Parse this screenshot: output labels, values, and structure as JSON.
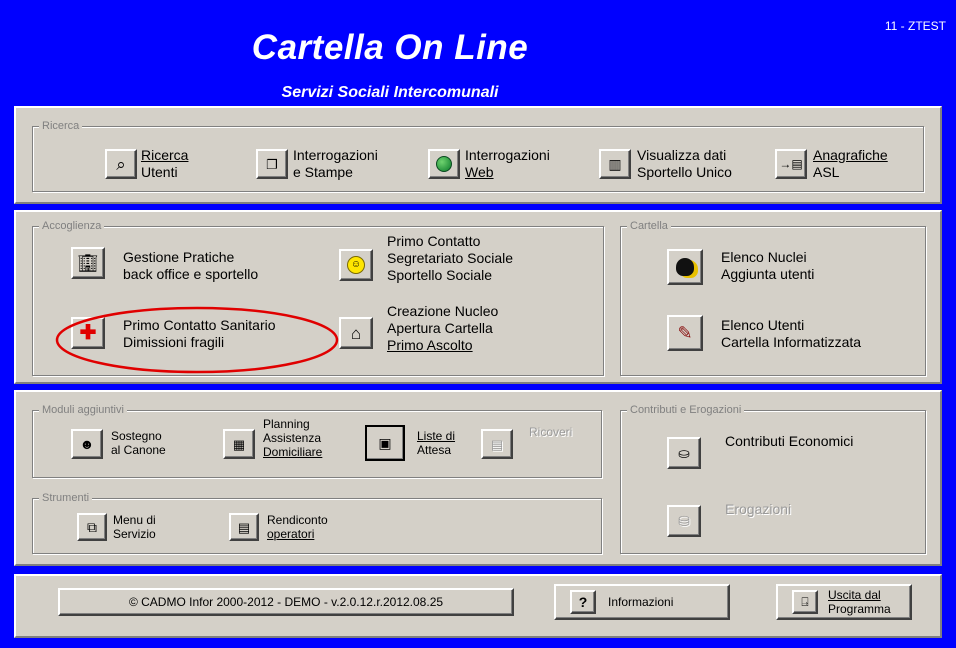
{
  "header": {
    "title": "Cartella On Line",
    "subtitle": "Servizi Sociali Intercomunali",
    "env_code": "11 - ZTEST"
  },
  "ricerca": {
    "legend": "Ricerca",
    "ricerca_utenti": [
      "Ricerca",
      "Utenti"
    ],
    "interrogazioni_stampe": [
      "Interrogazioni",
      "e Stampe"
    ],
    "interrogazioni_web": [
      "Interrogazioni",
      "Web"
    ],
    "sportello_unico": [
      "Visualizza dati",
      "Sportello Unico"
    ],
    "anagrafiche_asl": [
      "Anagrafiche",
      "ASL"
    ]
  },
  "accoglienza": {
    "legend": "Accoglienza",
    "gestione_pratiche": [
      "Gestione Pratiche",
      "back office e sportello"
    ],
    "primo_contatto": [
      "Primo Contatto",
      "Segretariato Sociale",
      "Sportello Sociale"
    ],
    "primo_contatto_sanitario": [
      "Primo Contatto Sanitario",
      "Dimissioni fragili"
    ],
    "creazione_nucleo": [
      "Creazione Nucleo",
      "Apertura Cartella",
      "Primo Ascolto"
    ]
  },
  "cartella": {
    "legend": "Cartella",
    "elenco_nuclei": [
      "Elenco Nuclei",
      "Aggiunta utenti"
    ],
    "elenco_utenti": [
      "Elenco Utenti",
      "Cartella Informatizzata"
    ]
  },
  "moduli": {
    "legend": "Moduli aggiuntivi",
    "sostegno": [
      "Sostegno",
      "al Canone"
    ],
    "planning": [
      "Planning",
      "Assistenza",
      "Domiciliare"
    ],
    "liste": [
      "Liste di",
      "Attesa"
    ],
    "ricoveri": "Ricoveri"
  },
  "strumenti": {
    "legend": "Strumenti",
    "menu_servizio": [
      "Menu di",
      "Servizio"
    ],
    "rendiconto": [
      "Rendiconto",
      "operatori"
    ]
  },
  "contributi": {
    "legend": "Contributi e Erogazioni",
    "contributi_economici": "Contributi Economici",
    "erogazioni": "Erogazioni"
  },
  "footer": {
    "version": "© CADMO Infor 2000-2012 - DEMO - v.2.0.12.r.2012.08.25",
    "informazioni": "Informazioni",
    "uscita": [
      "Uscita dal",
      "Programma"
    ]
  },
  "colors": {
    "window_bg": "#0000ff",
    "panel_bg": "#d4d0c8",
    "highlight_circle": "#e00000"
  },
  "icons": {
    "ricerca_utenti": "magnifier-icon",
    "interrogazioni": "documents-icon",
    "web": "globe-icon",
    "sportello": "book-icon",
    "asl": "arrow-card-icon",
    "gestione": "building-icon",
    "primo_contatto": "smiley-icon",
    "sanitario": "red-cross-icon",
    "nucleo": "house-icon",
    "nuclei": "head-icon",
    "utenti": "folder-pen-icon",
    "sostegno": "mask-icon",
    "planning": "calendar-icon",
    "liste": "list-icon",
    "ricoveri": "bed-icon",
    "menu": "window-icon",
    "rendiconto": "report-icon",
    "contributi": "money-icon",
    "erogazioni": "coins-icon",
    "info": "question-icon",
    "exit": "exit-door-icon"
  }
}
